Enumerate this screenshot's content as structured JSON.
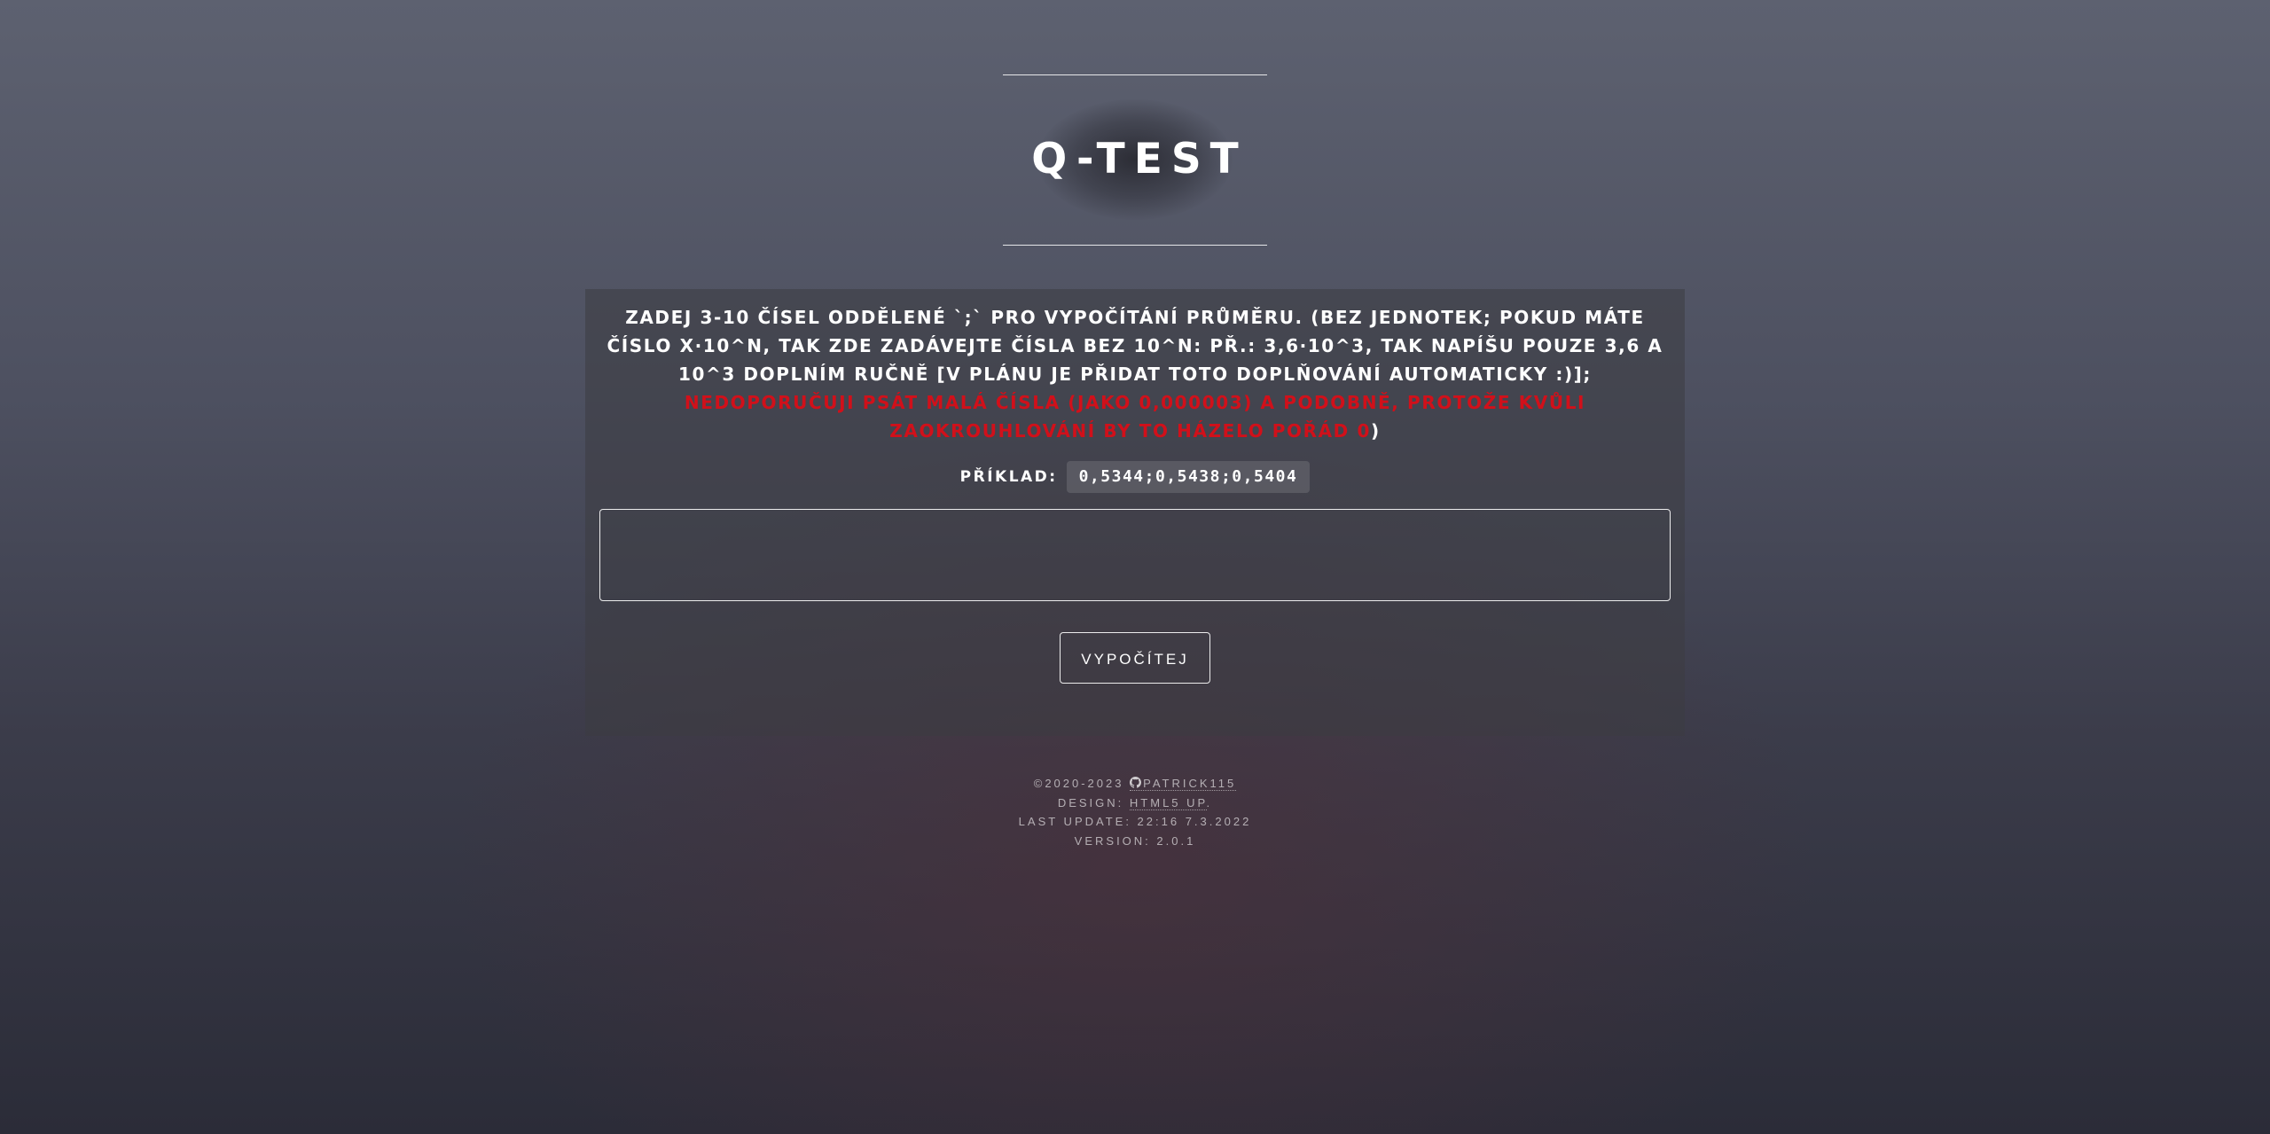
{
  "header": {
    "title": "Q-TEST"
  },
  "form": {
    "description": "Zadej 3-10 čísel oddělené `;` pro vypočítání průměru. (bez jednotek; pokud máte číslo x·10^n, tak zde zadávejte čísla bez 10^n: př.: 3,6·10^3, tak napíšu pouze 3,6 a 10^3 doplním ručně [v plánu je přidat toto doplňování automaticky :)];",
    "warning": "Nedoporučuji psát malá čísla (jako 0,000003) a podobně, protože kvůli zaokrouhlování by to házelo pořád 0",
    "closing_paren": ")",
    "example_label": "Příklad:",
    "example_value": "0,5344;0,5438;0,5404",
    "input_value": "",
    "input_placeholder": "",
    "submit_label": "Vypočítej"
  },
  "footer": {
    "copyright_prefix": "©2020-2023",
    "author_icon": "github-icon",
    "author_link": "Patrick115",
    "design_prefix": "Design:",
    "design_link": "HTML5 UP",
    "design_suffix": ".",
    "last_update": "Last Update: 22:16 7.3.2022",
    "version": "Version: 2.0.1"
  }
}
